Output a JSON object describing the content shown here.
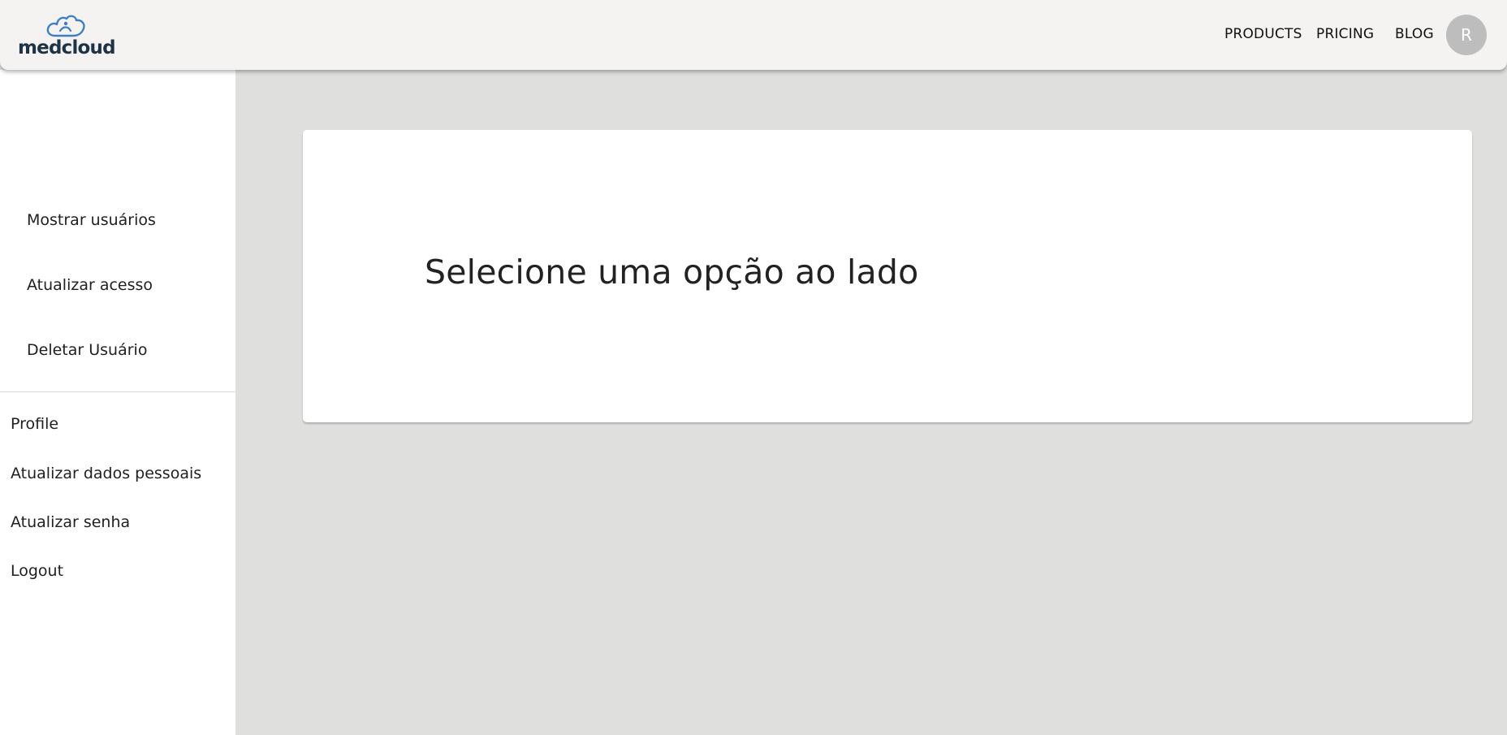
{
  "header": {
    "logo_text": "medcloud",
    "nav": {
      "products": "PRODUCTS",
      "pricing": "PRICING",
      "blog": "BLOG"
    },
    "avatar_initial": "R"
  },
  "sidebar": {
    "admin_items": [
      {
        "label": "Mostrar usuários"
      },
      {
        "label": "Atualizar acesso"
      },
      {
        "label": "Deletar Usuário"
      }
    ],
    "account_items": [
      {
        "label": "Profile"
      },
      {
        "label": "Atualizar dados pessoais"
      },
      {
        "label": "Atualizar senha"
      },
      {
        "label": "Logout"
      }
    ]
  },
  "main": {
    "card_title": "Selecione uma opção ao lado"
  },
  "colors": {
    "topbar_bg": "#f4f3f2",
    "page_bg": "#dfe0de",
    "logo_text": "#1e3346",
    "logo_mark": "#3c7fc4",
    "avatar_bg": "#bdbdbd"
  }
}
